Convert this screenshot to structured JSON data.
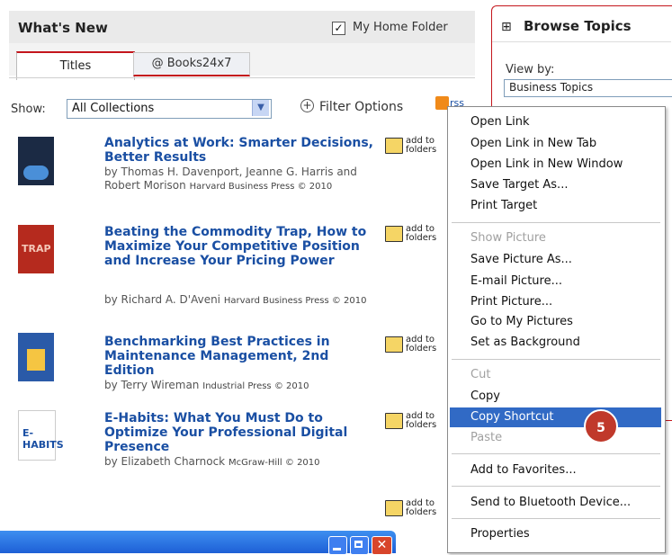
{
  "whats_new": {
    "title": "What's New",
    "home_folder_label": "My Home Folder",
    "home_folder_checked": true,
    "tabs": [
      {
        "label": "Titles",
        "active": true
      },
      {
        "label": "@ Books24x7",
        "active": false
      }
    ],
    "show_label": "Show:",
    "show_value": "All Collections",
    "filter_label": "Filter Options",
    "rss_label": "rss"
  },
  "books": [
    {
      "title": "Analytics at Work: Smarter Decisions, Better Results",
      "authors": "by Thomas H. Davenport, Jeanne G. Harris and Robert Morison",
      "publisher": "Harvard Business Press © 2010",
      "folder_label": "add to folders",
      "cover_color": "#1b2a44"
    },
    {
      "title": "Beating the Commodity Trap, How to Maximize Your Competitive Position and Increase Your Pricing Power",
      "authors": "by Richard A. D'Aveni",
      "publisher": "Harvard Business Press © 2010",
      "folder_label": "add to folders",
      "cover_color": "#b52a1e"
    },
    {
      "title": "Benchmarking Best Practices in Maintenance Management, 2nd Edition",
      "authors": "by Terry Wireman",
      "publisher": "Industrial Press © 2010",
      "folder_label": "add to folders",
      "cover_color": "#2a5aa8"
    },
    {
      "title": "E-Habits: What You Must Do to Optimize Your Professional Digital Presence",
      "authors": "by Elizabeth Charnock",
      "publisher": "McGraw-Hill © 2010",
      "folder_label": "add to folders",
      "cover_color": "#ffffff"
    }
  ],
  "extra_folder_label": "add to folders",
  "browse_topics": {
    "title": "Browse Topics",
    "view_by_label": "View by:",
    "view_by_value": "Business Topics"
  },
  "context_menu": {
    "items": [
      {
        "label": "Open Link",
        "disabled": false
      },
      {
        "label": "Open Link in New Tab",
        "disabled": false
      },
      {
        "label": "Open Link in New Window",
        "disabled": false
      },
      {
        "label": "Save Target As...",
        "disabled": false
      },
      {
        "label": "Print Target",
        "disabled": false
      },
      {
        "label": "Show Picture",
        "disabled": true
      },
      {
        "label": "Save Picture As...",
        "disabled": false
      },
      {
        "label": "E-mail Picture...",
        "disabled": false
      },
      {
        "label": "Print Picture...",
        "disabled": false
      },
      {
        "label": "Go to My Pictures",
        "disabled": false
      },
      {
        "label": "Set as Background",
        "disabled": false
      },
      {
        "label": "Cut",
        "disabled": true
      },
      {
        "label": "Copy",
        "disabled": false
      },
      {
        "label": "Copy Shortcut",
        "disabled": false,
        "highlighted": true
      },
      {
        "label": "Paste",
        "disabled": true
      },
      {
        "label": "Add to Favorites...",
        "disabled": false
      },
      {
        "label": "Send to Bluetooth Device...",
        "disabled": false
      },
      {
        "label": "Properties",
        "disabled": false
      }
    ]
  },
  "callouts": {
    "step_5": "5"
  },
  "colors": {
    "accent_red": "#c4161c",
    "link_blue": "#1a4fa3",
    "menu_highlight": "#316ac5",
    "callout_red": "#c0392b"
  }
}
